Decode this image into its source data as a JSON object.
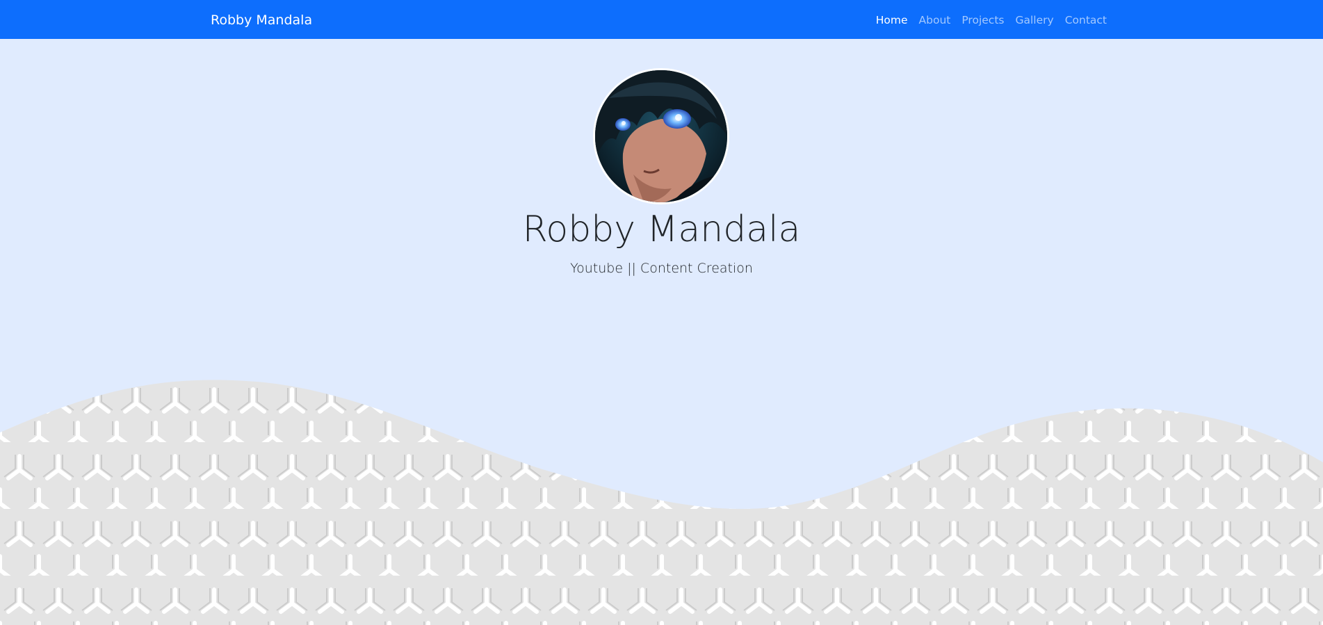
{
  "navbar": {
    "brand": "Robby Mandala",
    "links": [
      {
        "label": "Home",
        "active": true
      },
      {
        "label": "About",
        "active": false
      },
      {
        "label": "Projects",
        "active": false
      },
      {
        "label": "Gallery",
        "active": false
      },
      {
        "label": "Contact",
        "active": false
      }
    ]
  },
  "hero": {
    "name": "Robby Mandala",
    "tagline": "Youtube || Content Creation"
  },
  "colors": {
    "navbar": "#0d6efd",
    "background": "#e0ebfe",
    "wave_pattern_base": "#e6e6e6",
    "wave_pattern_line": "#ffffff"
  }
}
